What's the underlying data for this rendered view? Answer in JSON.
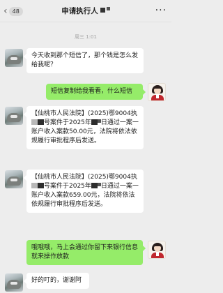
{
  "header": {
    "back_label": "‹",
    "unread_count": "48",
    "title": "申请执行人",
    "more_label": "···"
  },
  "chat": {
    "timestamp": "周三 1:01",
    "messages": [
      {
        "side": "left",
        "parts": [
          "今天收到那个短信了，那个钱是怎么发给我呢？"
        ]
      },
      {
        "side": "right",
        "parts": [
          "短信复制给我看看，什么短信"
        ]
      },
      {
        "side": "left",
        "parts": [
          "【仙桃市人民法院】(2025)鄂9004执",
          "号案件于2025年",
          "日通过一案一账户收入案款50.00元，法院将依法依规履行审批程序后发送。"
        ]
      },
      {
        "side": "left",
        "parts": [
          "【仙桃市人民法院】(2025)鄂9004执",
          "号案件于2025年",
          "日通过一案一账户收入案款659.00元，法院将依法依规履行审批程序后发送。"
        ]
      },
      {
        "side": "right",
        "parts": [
          "哦哦哦，马上会通过你留下来银行信息就来操作放款"
        ]
      },
      {
        "side": "left",
        "parts": [
          "好的叮的，谢谢阿"
        ]
      }
    ]
  },
  "colors": {
    "bubble_self": "#95ec69",
    "bubble_other": "#ffffff",
    "background": "#ededed"
  }
}
